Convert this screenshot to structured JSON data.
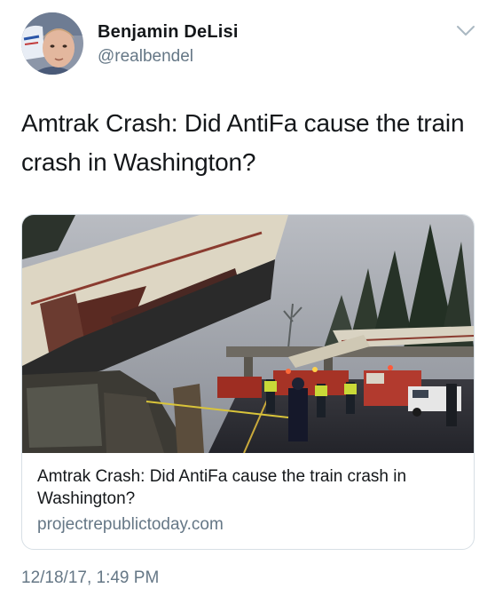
{
  "author": {
    "display_name": "Benjamin DeLisi",
    "handle": "@realbendel"
  },
  "tweet": {
    "text": "Amtrak Crash: Did AntiFa cause the train crash in Washington?"
  },
  "card": {
    "title": "Amtrak Crash: Did AntiFa cause the train crash in Washington?",
    "domain": "projectrepublictoday.com"
  },
  "timestamp": "12/18/17, 1:49 PM",
  "icons": {
    "caret": "chevron-down-icon",
    "avatar": "avatar"
  },
  "colors": {
    "text": "#14171a",
    "secondary": "#657786",
    "border": "#d7dfe5"
  }
}
